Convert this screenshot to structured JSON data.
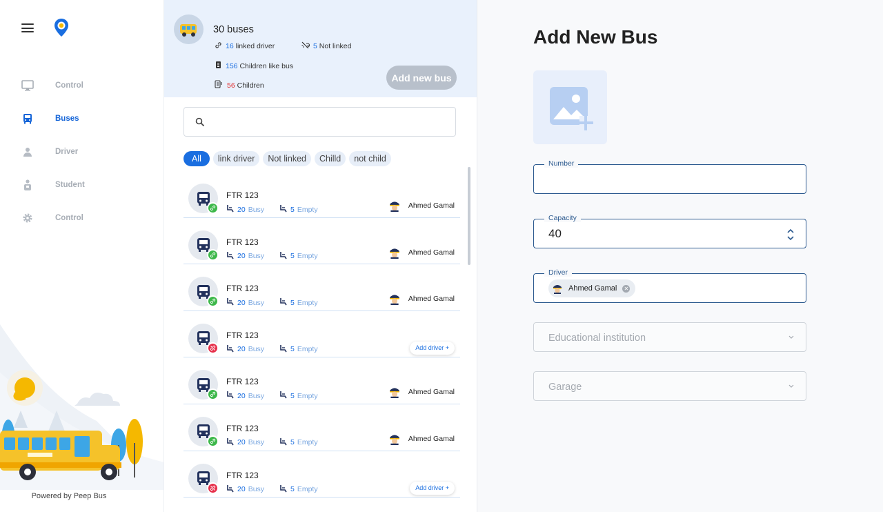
{
  "sidebar": {
    "items": [
      {
        "label": "Control",
        "icon": "monitor-icon"
      },
      {
        "label": "Buses",
        "icon": "bus-icon"
      },
      {
        "label": "Driver",
        "icon": "driver-icon"
      },
      {
        "label": "Student",
        "icon": "student-icon"
      },
      {
        "label": "Control",
        "icon": "gear-icon"
      }
    ],
    "powered_by": "Powered by Peep Bus"
  },
  "summary": {
    "title": "30 buses",
    "linked_num": "16",
    "linked_label": "linked driver",
    "not_linked_num": "5",
    "not_linked_label": "Not linked",
    "children_bus_num": "156",
    "children_bus_label": "Children like bus",
    "children_num": "56",
    "children_label": "Children",
    "add_button": "Add new bus"
  },
  "search": {
    "placeholder": ""
  },
  "filters": {
    "all": "All",
    "link_driver": "link driver",
    "not_linked": "Not linked",
    "child": "Chilld",
    "not_child": "not child"
  },
  "buses": [
    {
      "plate": "FTR 123",
      "busy_num": "20",
      "busy_label": "Busy",
      "empty_num": "5",
      "empty_label": "Empty",
      "linked": true,
      "driver": "Ahmed Gamal"
    },
    {
      "plate": "FTR 123",
      "busy_num": "20",
      "busy_label": "Busy",
      "empty_num": "5",
      "empty_label": "Empty",
      "linked": true,
      "driver": "Ahmed Gamal"
    },
    {
      "plate": "FTR 123",
      "busy_num": "20",
      "busy_label": "Busy",
      "empty_num": "5",
      "empty_label": "Empty",
      "linked": true,
      "driver": "Ahmed Gamal"
    },
    {
      "plate": "FTR 123",
      "busy_num": "20",
      "busy_label": "Busy",
      "empty_num": "5",
      "empty_label": "Empty",
      "linked": false,
      "add_driver": "Add driver +"
    },
    {
      "plate": "FTR 123",
      "busy_num": "20",
      "busy_label": "Busy",
      "empty_num": "5",
      "empty_label": "Empty",
      "linked": true,
      "driver": "Ahmed Gamal"
    },
    {
      "plate": "FTR 123",
      "busy_num": "20",
      "busy_label": "Busy",
      "empty_num": "5",
      "empty_label": "Empty",
      "linked": true,
      "driver": "Ahmed Gamal"
    },
    {
      "plate": "FTR 123",
      "busy_num": "20",
      "busy_label": "Busy",
      "empty_num": "5",
      "empty_label": "Empty",
      "linked": false,
      "add_driver": "Add driver +"
    }
  ],
  "form": {
    "title": "Add New Bus",
    "number_label": "Number",
    "number_value": "",
    "capacity_label": "Capacity",
    "capacity_value": "40",
    "driver_label": "Driver",
    "driver_value": "Ahmed Gamal",
    "institution_placeholder": "Educational institution",
    "garage_placeholder": "Garage"
  },
  "colors": {
    "accent": "#1a6ee0",
    "linked": "#3db84a",
    "unlinked": "#e6304b",
    "header_bg": "#e9f1fc"
  }
}
